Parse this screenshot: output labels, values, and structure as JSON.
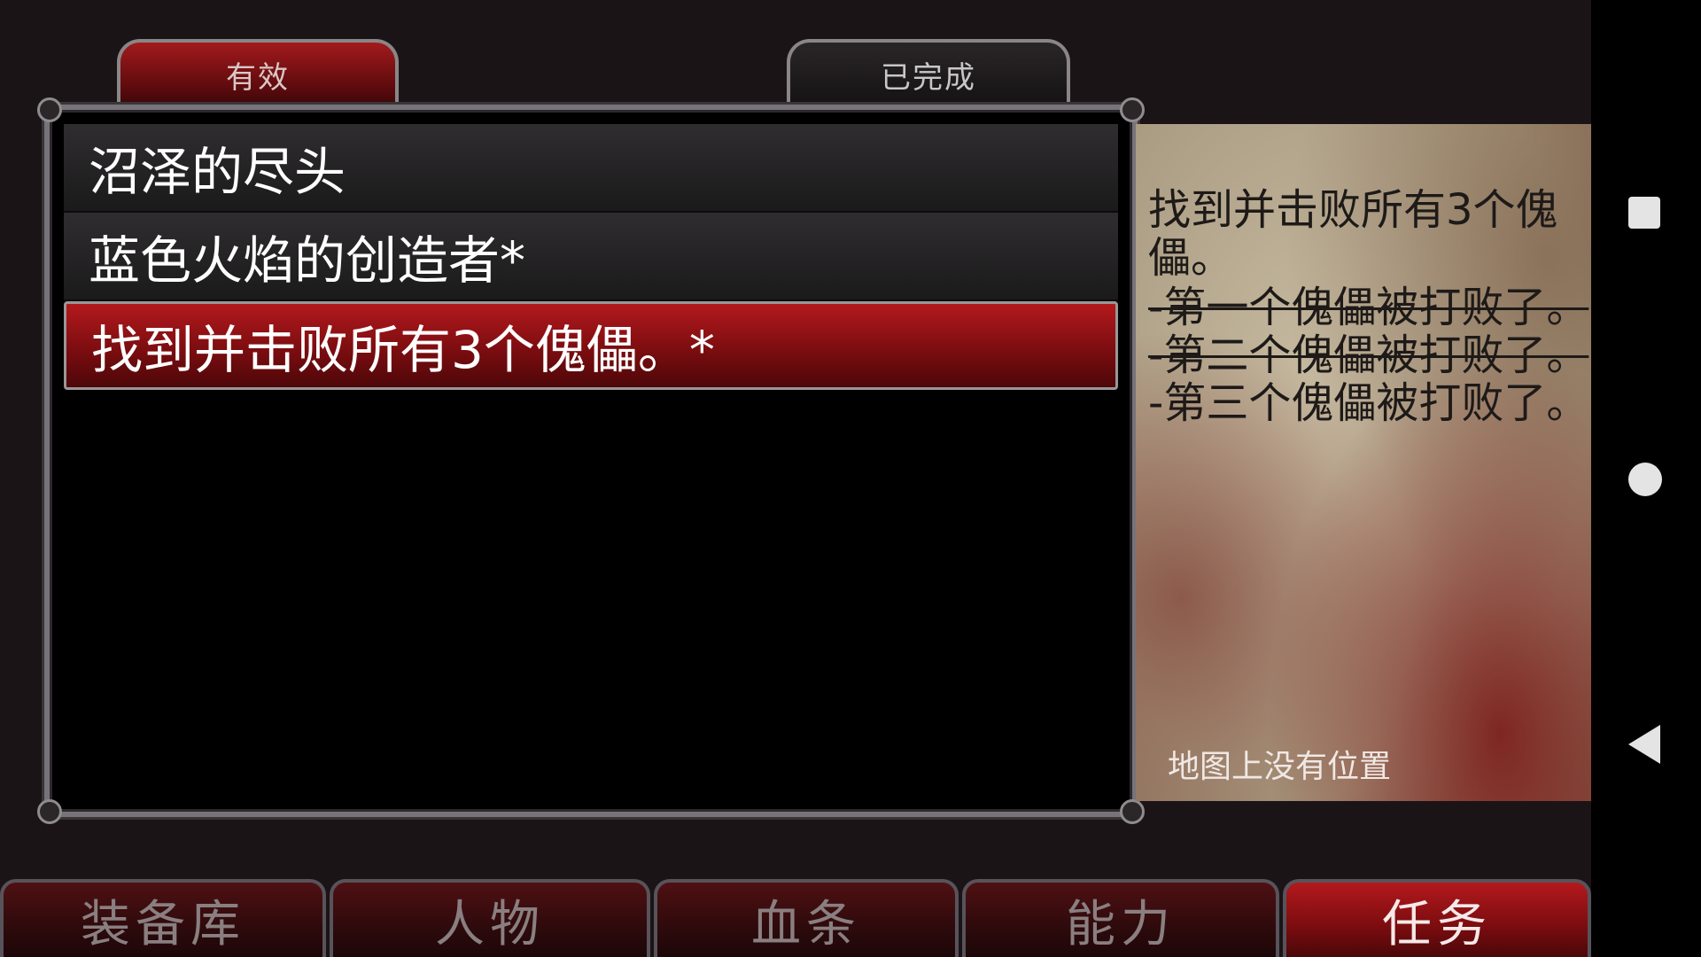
{
  "tabs": {
    "active": "有效",
    "completed": "已完成"
  },
  "quests": [
    {
      "title": "沼泽的尽头"
    },
    {
      "title": "蓝色火焰的创造者*"
    },
    {
      "title": "找到并击败所有3个傀儡。*",
      "selected": true
    }
  ],
  "description": {
    "title": "找到并击败所有3个傀儡。",
    "objectives": [
      {
        "text": "-第一个傀儡被打败了。",
        "done": true
      },
      {
        "text": "-第二个傀儡被打败了。",
        "done": true
      },
      {
        "text": "-第三个傀儡被打败了。",
        "done": false
      }
    ],
    "map_note": "地图上没有位置"
  },
  "bottom_menu": {
    "items": [
      {
        "label": "装备库"
      },
      {
        "label": "人物"
      },
      {
        "label": "血条"
      },
      {
        "label": "能力"
      },
      {
        "label": "任务",
        "active": true
      }
    ]
  },
  "colors": {
    "accent_red": "#a21a1c",
    "frame_gray": "#8a8688",
    "parchment": "#c7bba2"
  },
  "nav_icons": [
    "square-recents-icon",
    "circle-home-icon",
    "triangle-back-icon"
  ]
}
